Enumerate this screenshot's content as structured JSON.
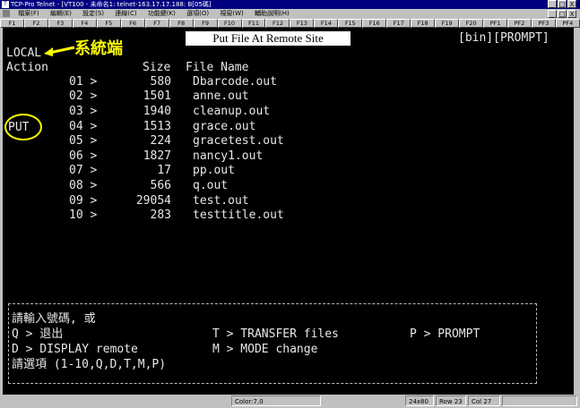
{
  "window": {
    "icon": "T",
    "title": "TCP-Pro Telnet - [VT100 - 未命名1: telnet-163.17.17.188: B[05碼]",
    "buttons": [
      "_",
      "□",
      "X"
    ]
  },
  "menubar": {
    "items": [
      "檔案(F)",
      "編輯(E)",
      "設定(S)",
      "連線(C)",
      "功能鍵(K)",
      "選項(O)",
      "視窗(W)",
      "輔助說明(H)"
    ],
    "mdi_buttons": [
      "_",
      "□",
      "X"
    ]
  },
  "fkeys": [
    "F1",
    "F2",
    "F3",
    "F4",
    "F5",
    "F6",
    "F7",
    "F8",
    "F9",
    "F10",
    "F11",
    "F12",
    "F13",
    "F14",
    "F15",
    "F16",
    "F17",
    "F18",
    "F19",
    "F20",
    "PF1",
    "PF2",
    "PF3",
    "PF4"
  ],
  "terminal": {
    "banner": "Put File At Remote Site",
    "mode": "[bin][PROMPT]",
    "local_label": "LOCAL",
    "annotation": "系統端",
    "action_label": "Action",
    "size_header": "Size",
    "name_header": "File Name",
    "put_label": "PUT",
    "files": [
      {
        "num": "01 >",
        "size": "580",
        "name": "Dbarcode.out"
      },
      {
        "num": "02 >",
        "size": "1501",
        "name": "anne.out"
      },
      {
        "num": "03 >",
        "size": "1940",
        "name": "cleanup.out"
      },
      {
        "num": "04 >",
        "size": "1513",
        "name": "grace.out"
      },
      {
        "num": "05 >",
        "size": "224",
        "name": "gracetest.out"
      },
      {
        "num": "06 >",
        "size": "1827",
        "name": "nancy1.out"
      },
      {
        "num": "07 >",
        "size": "17",
        "name": "pp.out"
      },
      {
        "num": "08 >",
        "size": "566",
        "name": "q.out"
      },
      {
        "num": "09 >",
        "size": "29054",
        "name": "test.out"
      },
      {
        "num": "10 >",
        "size": "283",
        "name": "testtitle.out"
      }
    ],
    "menu": {
      "prompt_line": "請輸入號碼, 或",
      "q_option": "Q > 退出",
      "d_option": "D > DISPLAY remote",
      "t_option": "T > TRANSFER files",
      "m_option": "M > MODE change",
      "p_option": "P > PROMPT",
      "select_prompt": "請選項 (1-10,Q,D,T,M,P)"
    }
  },
  "statusbar": {
    "color": "Color:7,0",
    "size": "24x80",
    "row": "Row 23",
    "col": "Col 27"
  }
}
